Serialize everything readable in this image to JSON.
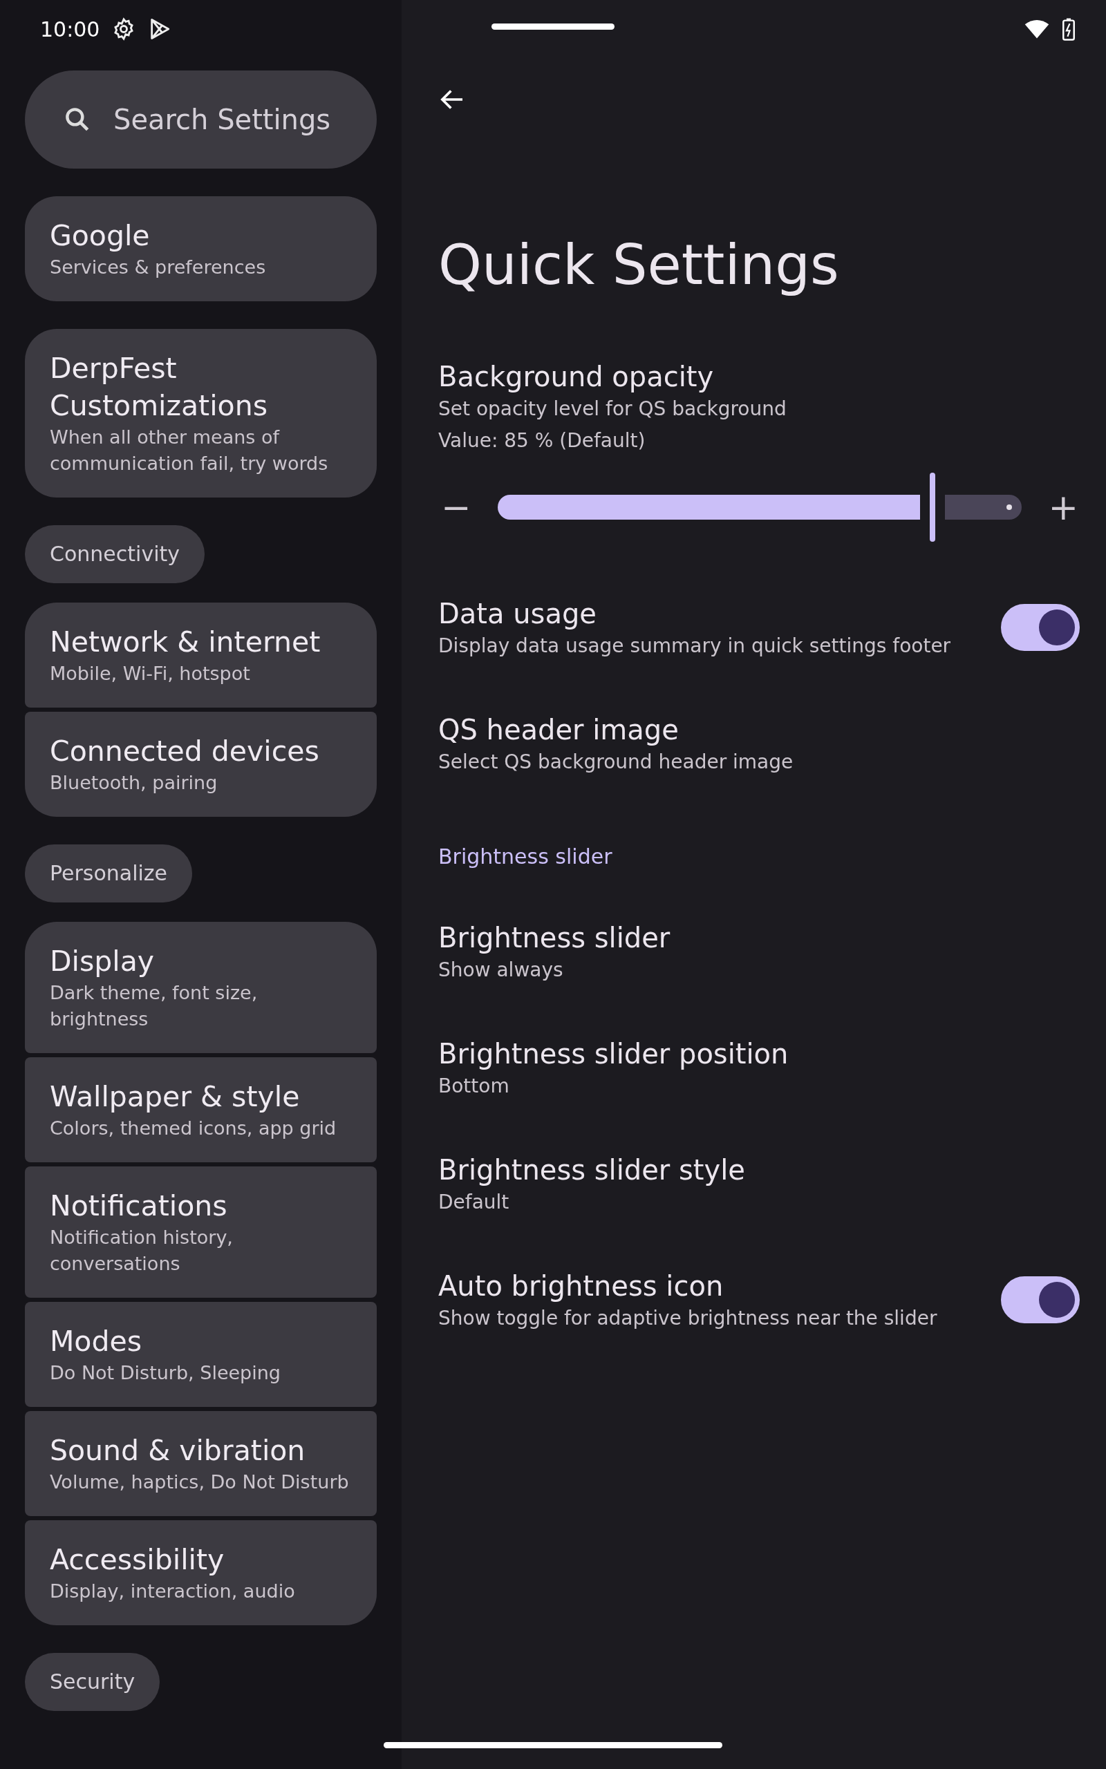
{
  "status_bar": {
    "time": "10:00"
  },
  "sidebar": {
    "search_placeholder": "Search Settings",
    "groups": [
      {
        "items": [
          {
            "title": "Google",
            "subtitle": "Services & preferences"
          }
        ]
      },
      {
        "items": [
          {
            "title": "DerpFest Customizations",
            "subtitle": "When all other means of communication fail, try words"
          }
        ]
      },
      {
        "header": "Connectivity",
        "items": [
          {
            "title": "Network & internet",
            "subtitle": "Mobile, Wi-Fi, hotspot"
          },
          {
            "title": "Connected devices",
            "subtitle": "Bluetooth, pairing"
          }
        ]
      },
      {
        "header": "Personalize",
        "items": [
          {
            "title": "Display",
            "subtitle": "Dark theme, font size, brightness"
          },
          {
            "title": "Wallpaper & style",
            "subtitle": "Colors, themed icons, app grid"
          },
          {
            "title": "Notifications",
            "subtitle": "Notification history, conversations"
          },
          {
            "title": "Modes",
            "subtitle": "Do Not Disturb, Sleeping"
          },
          {
            "title": "Sound & vibration",
            "subtitle": "Volume, haptics, Do Not Disturb"
          },
          {
            "title": "Accessibility",
            "subtitle": "Display, interaction, audio"
          }
        ]
      },
      {
        "header": "Security"
      }
    ]
  },
  "page": {
    "title": "Quick Settings",
    "settings": [
      {
        "kind": "slider",
        "title": "Background opacity",
        "subtitle": "Set opacity level for QS background",
        "value_text": "Value: 85 % (Default)",
        "level": 0.83,
        "minus": "−",
        "plus": "+"
      },
      {
        "kind": "switch",
        "title": "Data usage",
        "subtitle": "Display data usage summary in quick settings footer",
        "on": true
      },
      {
        "kind": "text",
        "title": "QS header image",
        "subtitle": "Select QS background header image"
      },
      {
        "kind": "header",
        "title": "Brightness slider"
      },
      {
        "kind": "text",
        "title": "Brightness slider",
        "subtitle": "Show always"
      },
      {
        "kind": "text",
        "title": "Brightness slider position",
        "subtitle": "Bottom"
      },
      {
        "kind": "text",
        "title": "Brightness slider style",
        "subtitle": "Default"
      },
      {
        "kind": "switch",
        "title": "Auto brightness icon",
        "subtitle": "Show toggle for adaptive brightness near the slider",
        "on": true
      }
    ]
  }
}
